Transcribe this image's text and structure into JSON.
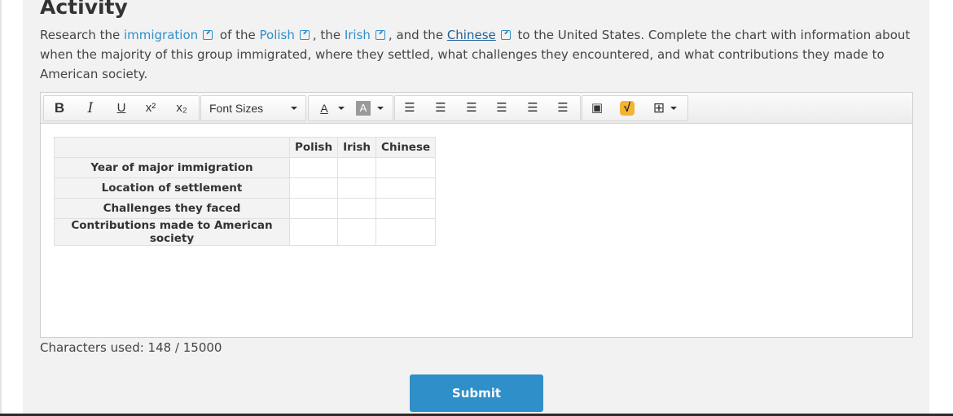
{
  "activity": {
    "title": "Activity",
    "text": {
      "p1": "Research the ",
      "link_immigration": "immigration",
      "p2": " of the ",
      "link_polish": "Polish",
      "p3": ", the ",
      "link_irish": "Irish",
      "p4": ", and the ",
      "link_chinese": "Chinese",
      "p5": " to the United States. Complete the chart with information about when the majority of this group immigrated, where they settled, what challenges they encountered, and what contributions they made to American society."
    }
  },
  "toolbar": {
    "bold": "B",
    "italic": "I",
    "underline": "U",
    "superscript": "x²",
    "subscript": "x₂",
    "font_sizes": "Font Sizes",
    "text_color": "A",
    "bg_color": "A",
    "bullet_list": "☰",
    "numbered_list": "☰",
    "indent": "☰",
    "align_left": "☰",
    "align_center": "☰",
    "align_right": "☰",
    "image": "▣",
    "math": "√",
    "table": "⊞"
  },
  "table": {
    "columns": [
      "Polish",
      "Irish",
      "Chinese"
    ],
    "rows": [
      "Year of major immigration",
      "Location of settlement",
      "Challenges they faced",
      "Contributions made to American society"
    ]
  },
  "status": {
    "chars_used": "Characters used: 148 / 15000"
  },
  "submit": {
    "label": "Submit"
  },
  "colors": {
    "accent": "#2f8fc9",
    "panel": "#f2f2f2"
  }
}
